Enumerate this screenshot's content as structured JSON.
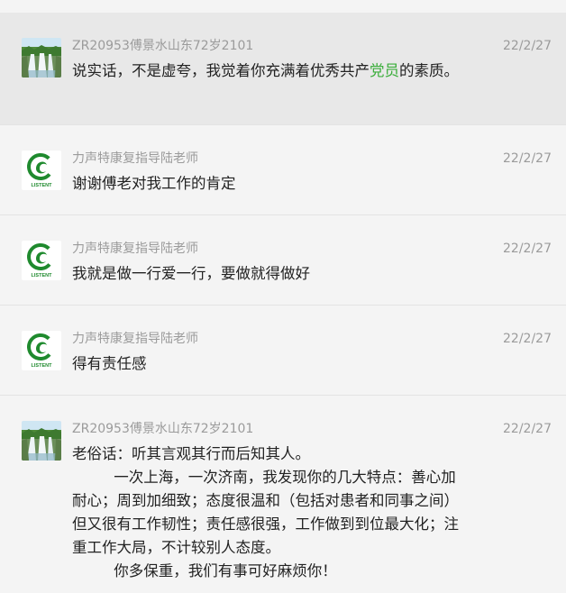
{
  "comments": [
    {
      "nickname": "ZR20953傅景水山东72岁2101",
      "time": "22/2/27",
      "avatar": "landscape-photo-avatar",
      "content_before": "说实话，不是虚夸，我觉着你充满着优秀共产",
      "content_link": "党员",
      "content_after": "的素质。"
    },
    {
      "nickname": "力声特康复指导陆老师",
      "time": "22/2/27",
      "avatar": "listent-logo-avatar",
      "content": "谢谢傅老对我工作的肯定"
    },
    {
      "nickname": "力声特康复指导陆老师",
      "time": "22/2/27",
      "avatar": "listent-logo-avatar",
      "content": "我就是做一行爱一行，要做就得做好"
    },
    {
      "nickname": "力声特康复指导陆老师",
      "time": "22/2/27",
      "avatar": "listent-logo-avatar",
      "content": "得有责任感"
    },
    {
      "nickname": "ZR20953傅景水山东72岁2101",
      "time": "22/2/27",
      "avatar": "landscape-photo-avatar",
      "paragraphs": [
        "老俗话：听其言观其行而后知其人。",
        "一次上海，一次济南，我发现你的几大特点：善心加耐心；周到加细致；态度很温和（包括对患者和同事之间）但又很有工作韧性；责任感很强，工作做到到位最大化；注重工作大局，不计较别人态度。",
        "你多保重，我们有事可好麻烦你！"
      ]
    }
  ],
  "logo_text": "LISTENT",
  "colors": {
    "link_green": "#3cae3c",
    "logo_green": "#1f8a2e",
    "meta_gray": "#9b9b9b",
    "highlight_bg": "#e8e8e8"
  }
}
